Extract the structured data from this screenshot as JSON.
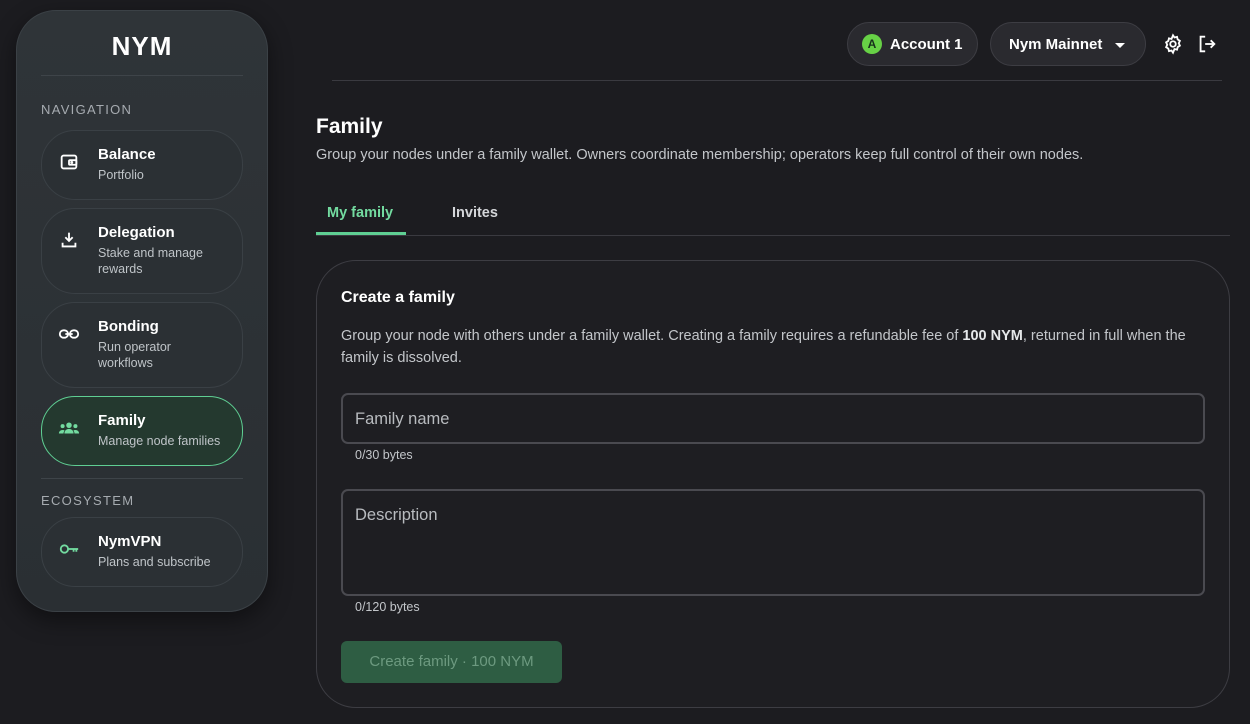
{
  "brand": {
    "logo": "NYM"
  },
  "sidebar": {
    "navigation_label": "NAVIGATION",
    "ecosystem_label": "ECOSYSTEM",
    "items": [
      {
        "title": "Balance",
        "subtitle": "Portfolio",
        "icon": "wallet-icon"
      },
      {
        "title": "Delegation",
        "subtitle": "Stake and manage rewards",
        "icon": "download-icon"
      },
      {
        "title": "Bonding",
        "subtitle": "Run operator workflows",
        "icon": "link-icon"
      },
      {
        "title": "Family",
        "subtitle": "Manage node families",
        "icon": "group-icon",
        "active": true
      }
    ],
    "ecosystem_items": [
      {
        "title": "NymVPN",
        "subtitle": "Plans and subscribe",
        "icon": "key-icon"
      }
    ]
  },
  "topbar": {
    "account_initial": "A",
    "account_label": "Account 1",
    "network_label": "Nym Mainnet",
    "settings_icon": "gear-icon",
    "logout_icon": "logout-icon"
  },
  "page": {
    "title": "Family",
    "subtitle": "Group your nodes under a family wallet. Owners coordinate membership; operators keep full control of their own nodes."
  },
  "tabs": [
    {
      "label": "My family",
      "active": true
    },
    {
      "label": "Invites",
      "active": false
    }
  ],
  "card": {
    "title": "Create a family",
    "desc_before": "Group your node with others under a family wallet. Creating a family requires a refundable fee of ",
    "desc_fee": "100 NYM",
    "desc_after": ", returned in full when the family is dissolved.",
    "name_field": {
      "placeholder": "Family name",
      "value": "",
      "counter": "0/30 bytes"
    },
    "description_field": {
      "placeholder": "Description",
      "value": "",
      "counter": "0/120 bytes"
    },
    "button_label": "Create family · 100 NYM"
  },
  "colors": {
    "accent": "#5fcf93",
    "avatar": "#67d146",
    "background": "#1c1c20",
    "button_disabled": "#2e5d43"
  }
}
